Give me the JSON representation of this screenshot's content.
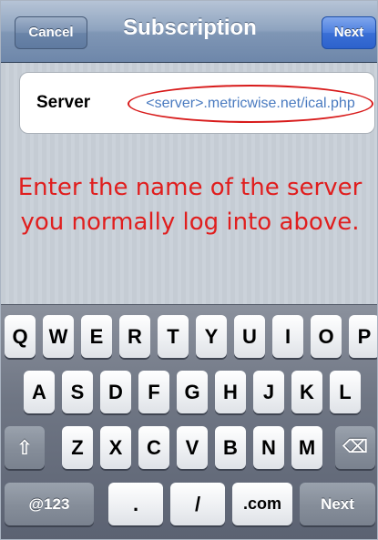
{
  "nav": {
    "title": "Subscription",
    "cancel_label": "Cancel",
    "next_label": "Next"
  },
  "form": {
    "server_label": "Server",
    "server_placeholder": "<server>.metricwise.net/ical.php"
  },
  "instruction": {
    "line1": "Enter the name of the server",
    "line2": "you normally log into above."
  },
  "keyboard": {
    "row1": [
      "Q",
      "W",
      "E",
      "R",
      "T",
      "Y",
      "U",
      "I",
      "O",
      "P"
    ],
    "row2": [
      "A",
      "S",
      "D",
      "F",
      "G",
      "H",
      "J",
      "K",
      "L"
    ],
    "row3": [
      "Z",
      "X",
      "C",
      "V",
      "B",
      "N",
      "M"
    ],
    "shift_icon": "⇧",
    "backspace_icon": "⌫",
    "numbers_label": "@123",
    "dot_label": ".",
    "slash_label": "/",
    "dotcom_label": ".com",
    "next_label": "Next"
  },
  "colors": {
    "instruction_text": "#e01e1e",
    "highlight_circle": "#d81b1b",
    "placeholder_text": "#4a7bc0",
    "next_button": "#3a6fd6"
  }
}
